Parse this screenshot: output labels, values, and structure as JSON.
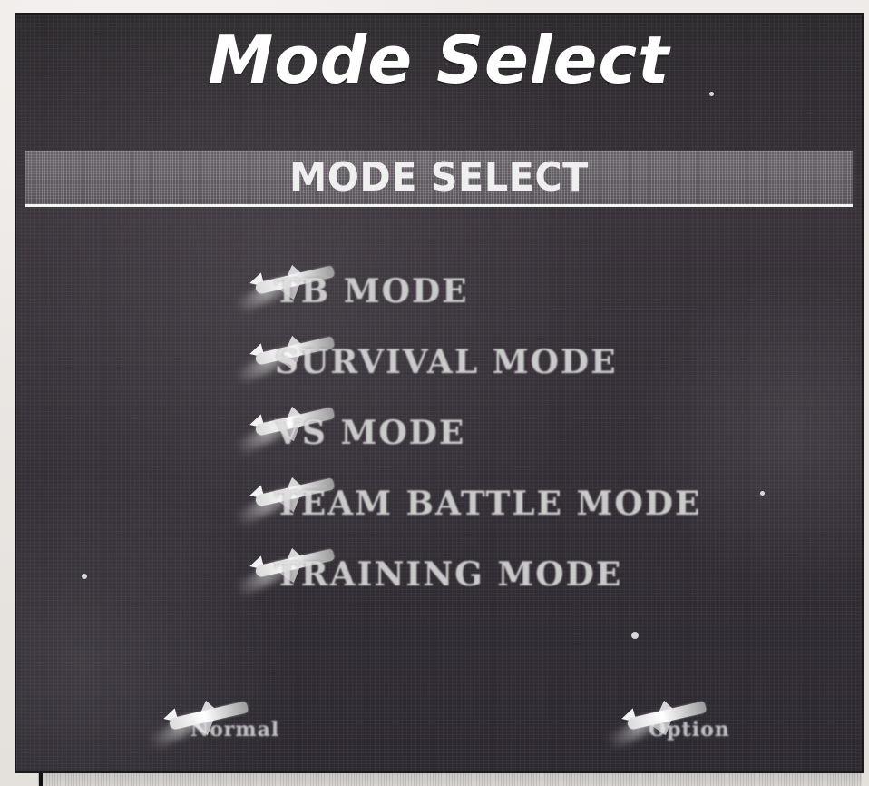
{
  "page": {
    "title": "Mode Select"
  },
  "menu_panel": {
    "title": "MODE SELECT"
  },
  "menu": {
    "items": [
      {
        "label": "TB MODE"
      },
      {
        "label": "SURVIVAL MODE"
      },
      {
        "label": "VS MODE"
      },
      {
        "label": "TEAM BATTLE MODE"
      },
      {
        "label": "TRAINING MODE"
      }
    ]
  },
  "bottom_actions": {
    "left_label": "Normal",
    "right_label": "Option"
  },
  "icons": {
    "menu_marker": "fighter-jet-icon",
    "bottom_marker": "fighter-jet-icon"
  },
  "colors": {
    "screen_bg": "#2f2b31",
    "band_bg": "#625d63",
    "title_text": "#ffffff",
    "menu_text": "#e5e5e5"
  }
}
